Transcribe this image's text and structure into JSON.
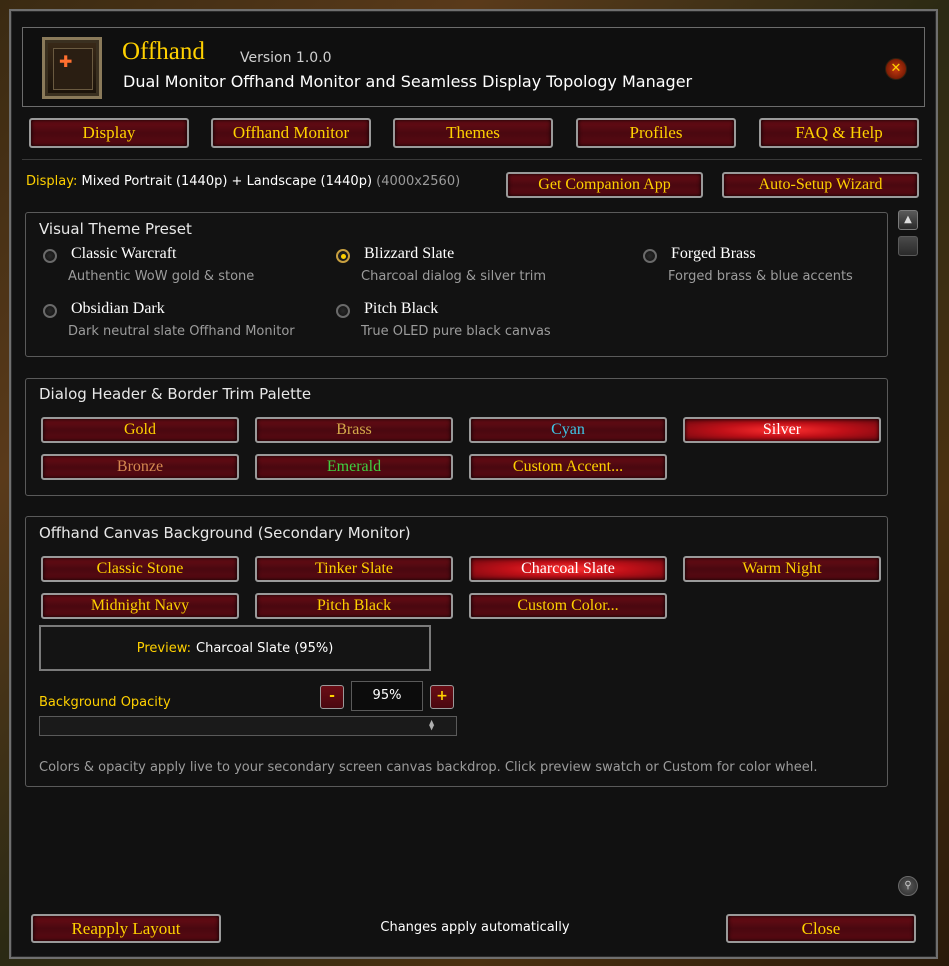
{
  "app": {
    "title": "Offhand",
    "version": "Version 1.0.0",
    "subtitle": "Dual Monitor Offhand Monitor and Seamless Display Topology Manager",
    "close_glyph": "✕"
  },
  "tabs": [
    {
      "label": "Display",
      "active": false
    },
    {
      "label": "Offhand Monitor",
      "active": false
    },
    {
      "label": "Themes",
      "active": true
    },
    {
      "label": "Profiles",
      "active": false
    },
    {
      "label": "FAQ & Help",
      "active": false
    }
  ],
  "display": {
    "label": "Display:",
    "value": "Mixed Portrait (1440p) + Landscape (1440p)",
    "dims": "(4000x2560)"
  },
  "top_buttons": {
    "companion": "Get Companion App",
    "wizard": "Auto-Setup Wizard"
  },
  "theme_preset": {
    "title": "Visual Theme Preset",
    "options": [
      {
        "label": "Classic Warcraft",
        "desc": "Authentic WoW gold & stone",
        "checked": false
      },
      {
        "label": "Blizzard Slate",
        "desc": "Charcoal dialog & silver trim",
        "checked": true
      },
      {
        "label": "Forged Brass",
        "desc": "Forged brass & blue accents",
        "checked": false
      },
      {
        "label": "Obsidian Dark",
        "desc": "Dark neutral slate Offhand Monitor",
        "checked": false
      },
      {
        "label": "Pitch Black",
        "desc": "True OLED pure black canvas",
        "checked": false
      }
    ]
  },
  "trim_palette": {
    "title": "Dialog Header & Border Trim Palette",
    "buttons": [
      {
        "label": "Gold",
        "color": "#ffd100",
        "active": false
      },
      {
        "label": "Brass",
        "color": "#d4a94a",
        "active": false
      },
      {
        "label": "Cyan",
        "color": "#3ec8e8",
        "active": false
      },
      {
        "label": "Silver",
        "color": "#ffffff",
        "active": true
      },
      {
        "label": "Bronze",
        "color": "#d48850",
        "active": false
      },
      {
        "label": "Emerald",
        "color": "#40d040",
        "active": false
      },
      {
        "label": "Custom Accent...",
        "color": "#ffd100",
        "active": false
      }
    ]
  },
  "canvas_bg": {
    "title": "Offhand Canvas Background (Secondary Monitor)",
    "buttons": [
      {
        "label": "Classic Stone",
        "active": false
      },
      {
        "label": "Tinker Slate",
        "active": false
      },
      {
        "label": "Charcoal Slate",
        "active": true
      },
      {
        "label": "Warm Night",
        "active": false
      },
      {
        "label": "Midnight Navy",
        "active": false
      },
      {
        "label": "Pitch Black",
        "active": false
      },
      {
        "label": "Custom Color...",
        "active": false
      }
    ],
    "preview_label": "Preview:",
    "preview_value": "Charcoal Slate (95%)",
    "opacity_label": "Background Opacity",
    "minus": "-",
    "plus": "+",
    "opacity_value": "95%",
    "opacity_fraction": 0.95,
    "note": "Colors & opacity apply live to your secondary screen canvas backdrop. Click preview swatch or Custom for color wheel."
  },
  "footer": {
    "reapply": "Reapply Layout",
    "status": "Changes apply automatically",
    "close": "Close"
  }
}
